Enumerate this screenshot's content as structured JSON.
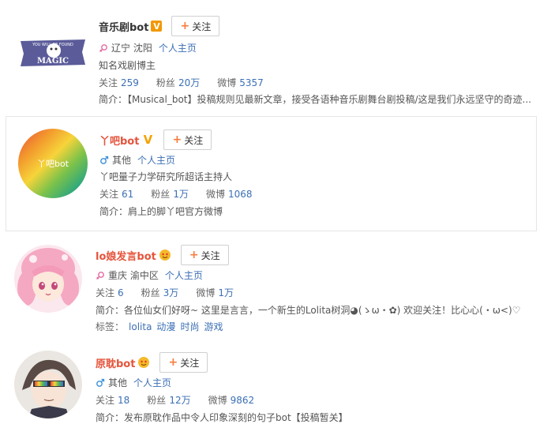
{
  "users": [
    {
      "name": "音乐剧bot",
      "badge": "V",
      "follow_label": "关注",
      "location": "辽宁 沈阳",
      "homepage": "个人主页",
      "description": "知名戏剧博主",
      "stats": {
        "following_label": "关注",
        "following": "259",
        "fans_label": "粉丝",
        "fans": "20万",
        "weibo_label": "微博",
        "weibo": "5357"
      },
      "intro": "简介：【Musical_bot】投稿规则见最新文章，接受各语种音乐剧舞台剧投稿/这是我们永远坚守的奇迹...",
      "avatar_text": "MAGIC"
    },
    {
      "name": "丫吧bot",
      "badge": "V",
      "follow_label": "关注",
      "location": "其他",
      "homepage": "个人主页",
      "description": "丫吧量子力学研究所超话主持人",
      "stats": {
        "following_label": "关注",
        "following": "61",
        "fans_label": "粉丝",
        "fans": "1万",
        "weibo_label": "微博",
        "weibo": "1068"
      },
      "intro": "简介：肩上的脚丫吧官方微博",
      "avatar_text": "丫吧bot"
    },
    {
      "name": "lo娘发言bot",
      "follow_label": "关注",
      "location": "重庆 渝中区",
      "homepage": "个人主页",
      "stats": {
        "following_label": "关注",
        "following": "6",
        "fans_label": "粉丝",
        "fans": "3万",
        "weibo_label": "微博",
        "weibo": "1万"
      },
      "intro": "简介：各位仙女们好呀~ 这里是言言，一个新生的Lolita树洞◕(ゝω・✿) 欢迎关注！比心心(・ω<)♡",
      "tags_label": "标签：",
      "tags": [
        "lolita",
        "动漫",
        "时尚",
        "游戏"
      ]
    },
    {
      "name": "原耽bot",
      "follow_label": "关注",
      "location": "其他",
      "homepage": "个人主页",
      "stats": {
        "following_label": "关注",
        "following": "18",
        "fans_label": "粉丝",
        "fans": "12万",
        "weibo_label": "微博",
        "weibo": "9862"
      },
      "intro": "简介：发布原耽作品中令人印象深刻的句子bot【投稿暂关】"
    }
  ]
}
